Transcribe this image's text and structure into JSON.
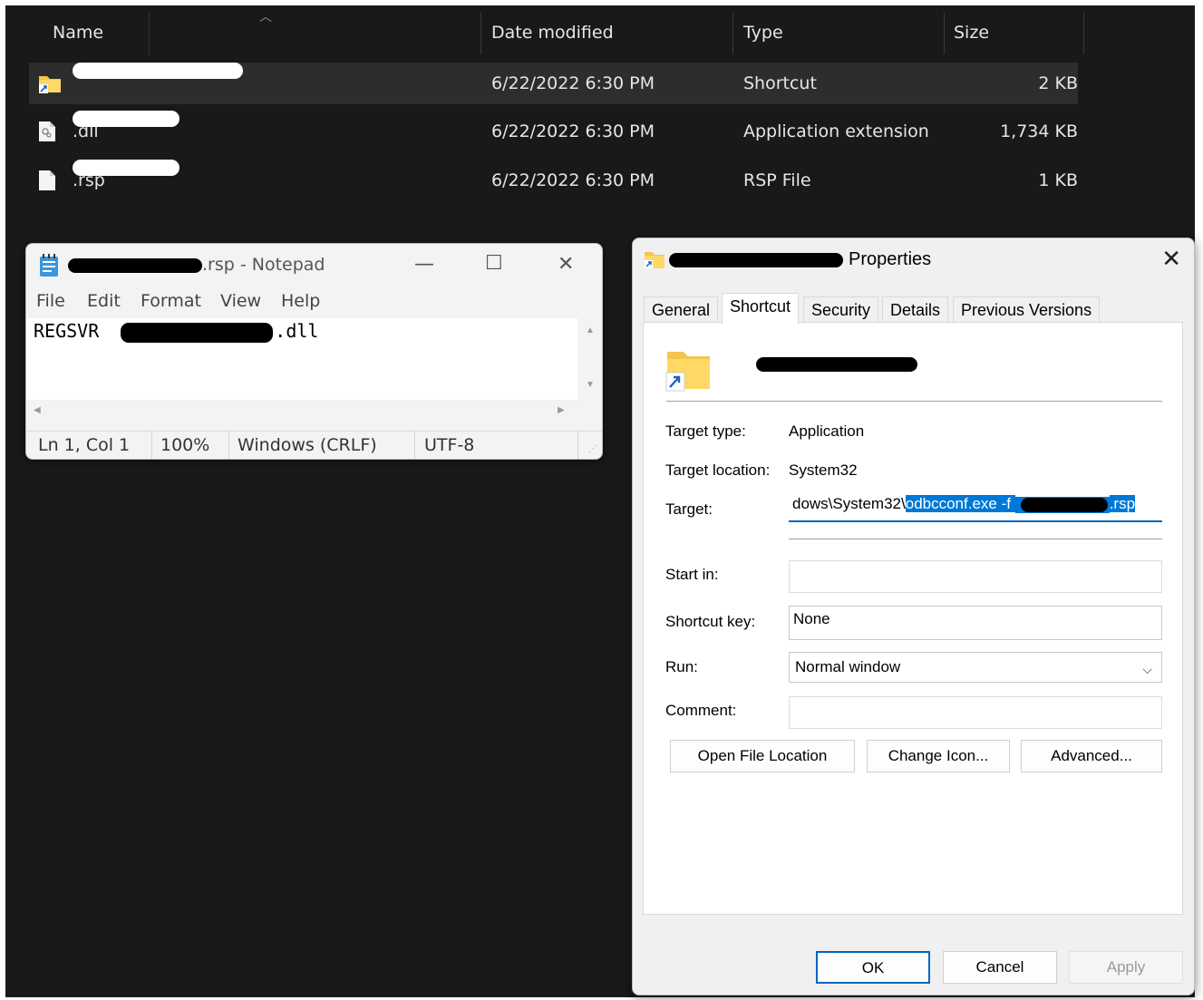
{
  "explorer": {
    "columns": {
      "name": "Name",
      "date_modified": "Date modified",
      "type": "Type",
      "size": "Size"
    },
    "files": [
      {
        "name_suffix": "",
        "date": "6/22/2022 6:30 PM",
        "type": "Shortcut",
        "size": "2 KB",
        "icon": "folder-shortcut-icon"
      },
      {
        "name_suffix": ".dll",
        "date": "6/22/2022 6:30 PM",
        "type": "Application extension",
        "size": "1,734 KB",
        "icon": "dll-file-icon"
      },
      {
        "name_suffix": ".rsp",
        "date": "6/22/2022 6:30 PM",
        "type": "RSP File",
        "size": "1 KB",
        "icon": "blank-file-icon"
      }
    ]
  },
  "notepad": {
    "title_suffix": ".rsp - Notepad",
    "menu": [
      "File",
      "Edit",
      "Format",
      "View",
      "Help"
    ],
    "content_prefix": "REGSVR",
    "content_suffix": ".dll",
    "status": {
      "position": "Ln 1, Col 1",
      "zoom": "100%",
      "line_ending": "Windows (CRLF)",
      "encoding": "UTF-8"
    }
  },
  "properties": {
    "title_suffix": "Properties",
    "tabs": [
      "General",
      "Shortcut",
      "Security",
      "Details",
      "Previous Versions"
    ],
    "active_tab": "Shortcut",
    "fields": {
      "target_type_label": "Target type:",
      "target_type_value": "Application",
      "target_location_label": "Target location:",
      "target_location_value": "System32",
      "target_label": "Target:",
      "target_value_prefix": "dows\\System32\\",
      "target_value_selected": "odbcconf.exe -f ",
      "target_value_suffix": ".rsp",
      "start_in_label": "Start in:",
      "start_in_value": "",
      "shortcut_key_label": "Shortcut key:",
      "shortcut_key_value": "None",
      "run_label": "Run:",
      "run_value": "Normal window",
      "comment_label": "Comment:",
      "comment_value": ""
    },
    "buttons": {
      "open_file_location": "Open File Location",
      "change_icon": "Change Icon...",
      "advanced": "Advanced...",
      "ok": "OK",
      "cancel": "Cancel",
      "apply": "Apply"
    },
    "colors": {
      "selection": "#0078d7",
      "accent": "#0067c0"
    }
  }
}
